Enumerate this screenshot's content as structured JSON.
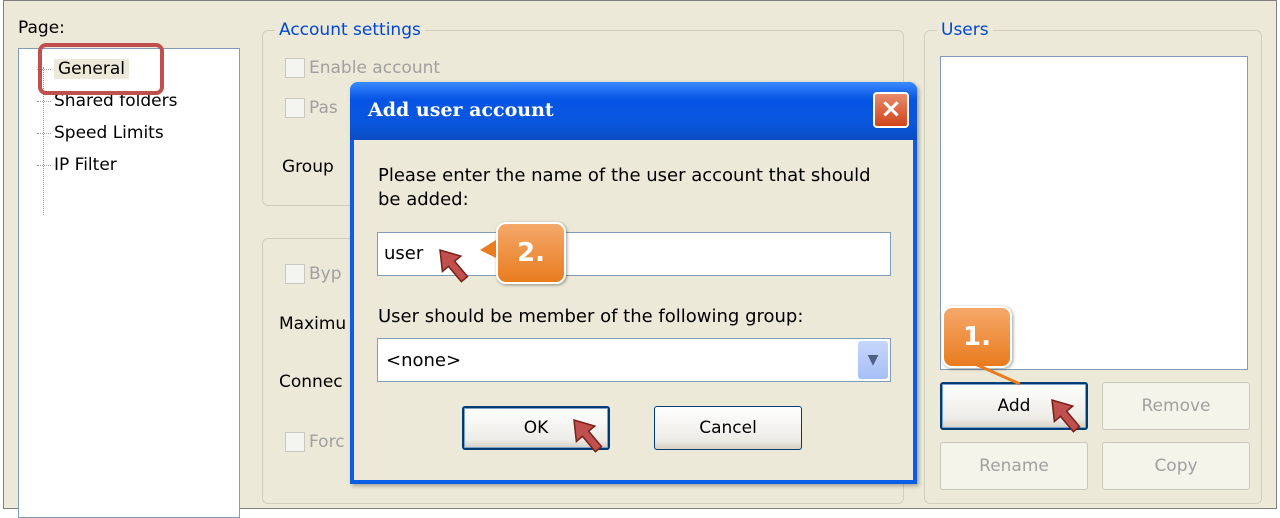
{
  "left_panel": {
    "page_label": "Page:",
    "tree": [
      "General",
      "Shared folders",
      "Speed Limits",
      "IP Filter"
    ]
  },
  "account_settings": {
    "legend": "Account settings",
    "enable_account": "Enable account",
    "password_partial": "Pas",
    "group_label": "Group"
  },
  "second_group": {
    "bypass_partial": "Byp",
    "maximum_partial": "Maximu",
    "connections_partial": "Connec",
    "force_partial": "Forc"
  },
  "users": {
    "legend": "Users",
    "buttons": {
      "add": "Add",
      "remove": "Remove",
      "rename": "Rename",
      "copy": "Copy"
    }
  },
  "dialog": {
    "title": "Add user account",
    "close": "×",
    "prompt": "Please enter the name of the user account that should be added:",
    "name_value": "user",
    "group_prompt": "User should be member of the following group:",
    "group_value": "<none>",
    "ok": "OK",
    "cancel": "Cancel"
  },
  "callouts": {
    "step1": "1.",
    "step2": "2."
  },
  "colors": {
    "highlight": "#c0504d",
    "callout": "#e87c1e",
    "titlebar": "#0a5ee6"
  }
}
